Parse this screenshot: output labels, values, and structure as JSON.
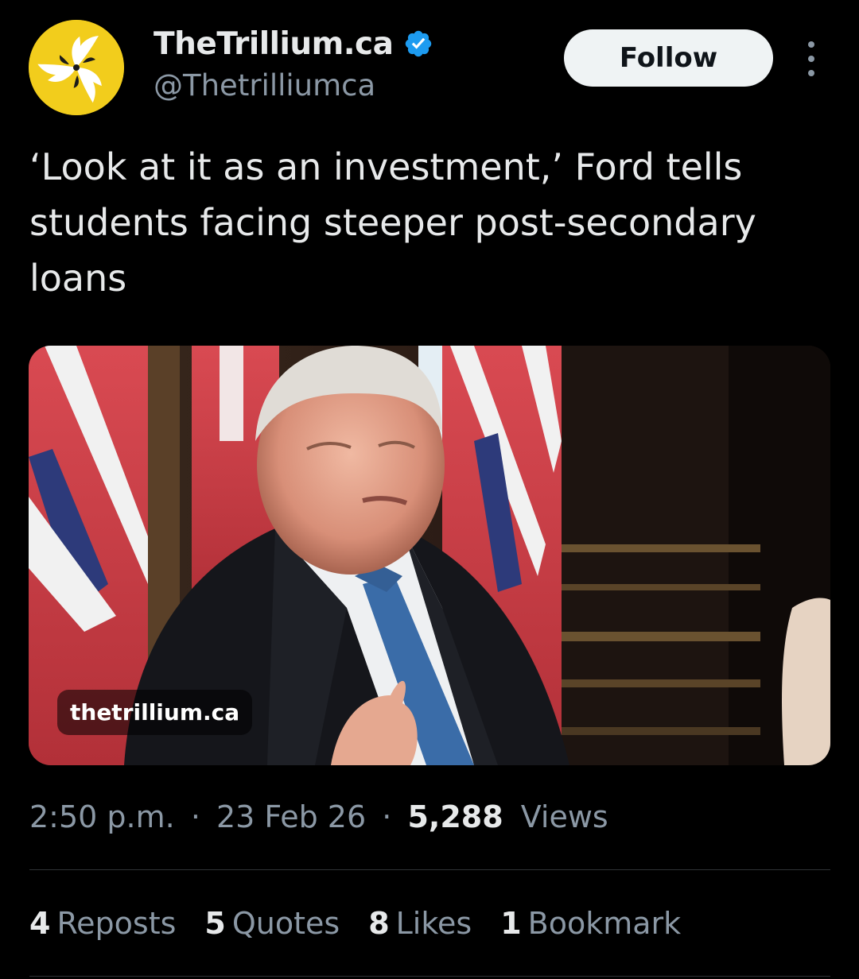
{
  "account": {
    "display_name": "TheTrillium.ca",
    "handle": "@Thetrilliumca",
    "verified_icon": "verified-badge-icon",
    "avatar_color": "#f2cd1c"
  },
  "actions": {
    "follow_label": "Follow",
    "more_icon": "more-vertical-icon"
  },
  "tweet": {
    "text": "‘Look at it as an investment,’ Ford tells students facing steeper post-secondary loans"
  },
  "media": {
    "source_label": "thetrillium.ca"
  },
  "meta": {
    "time": "2:50 p.m.",
    "separator": "·",
    "date": "23 Feb 26",
    "views_count": "5,288",
    "views_label": "Views"
  },
  "stats": [
    {
      "count": "4",
      "label": "Reposts"
    },
    {
      "count": "5",
      "label": "Quotes"
    },
    {
      "count": "8",
      "label": "Likes"
    },
    {
      "count": "1",
      "label": "Bookmark"
    }
  ],
  "colors": {
    "background": "#000000",
    "text_primary": "#e7e9ea",
    "text_secondary": "#8b98a5",
    "verified_blue": "#1d9bf0",
    "divider": "#2f3336"
  }
}
